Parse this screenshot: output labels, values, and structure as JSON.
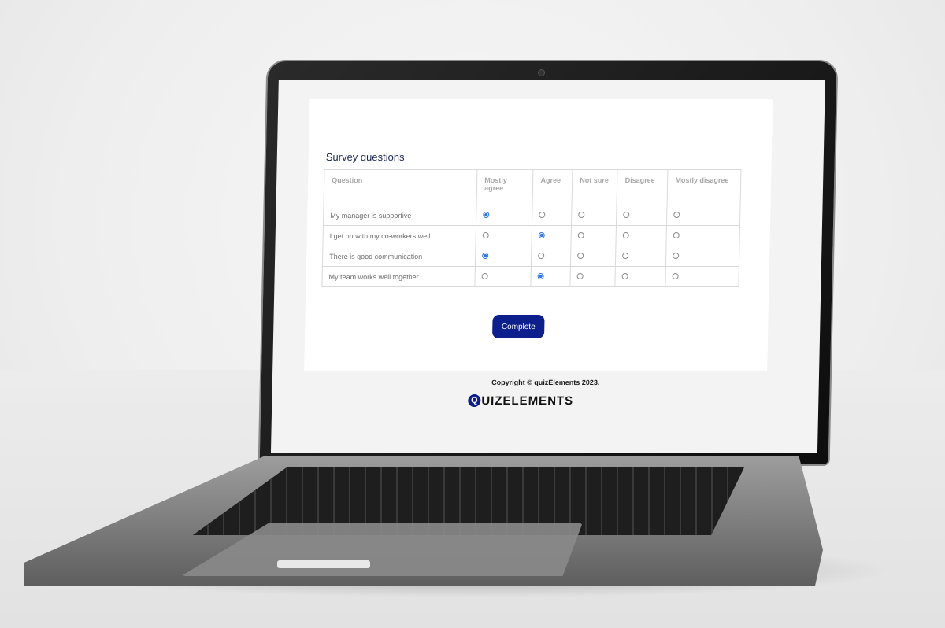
{
  "survey": {
    "title": "Survey questions",
    "columns": [
      "Question",
      "Mostly agree",
      "Agree",
      "Not sure",
      "Disagree",
      "Mostly disagree"
    ],
    "rows": [
      {
        "question": "My manager is supportive",
        "selected": "Mostly agree"
      },
      {
        "question": "I get on with my co-workers well",
        "selected": "Agree"
      },
      {
        "question": "There is good communication",
        "selected": "Mostly agree"
      },
      {
        "question": "My team works well together",
        "selected": "Agree"
      }
    ],
    "complete_label": "Complete"
  },
  "footer": {
    "copyright": "Copyright © quizElements 2023.",
    "logo_q": "Q",
    "logo_text": "UIZELEMENTS"
  },
  "colors": {
    "primary": "#0c1f8c",
    "radio_selected": "#2a74e8",
    "title": "#1c2856"
  }
}
